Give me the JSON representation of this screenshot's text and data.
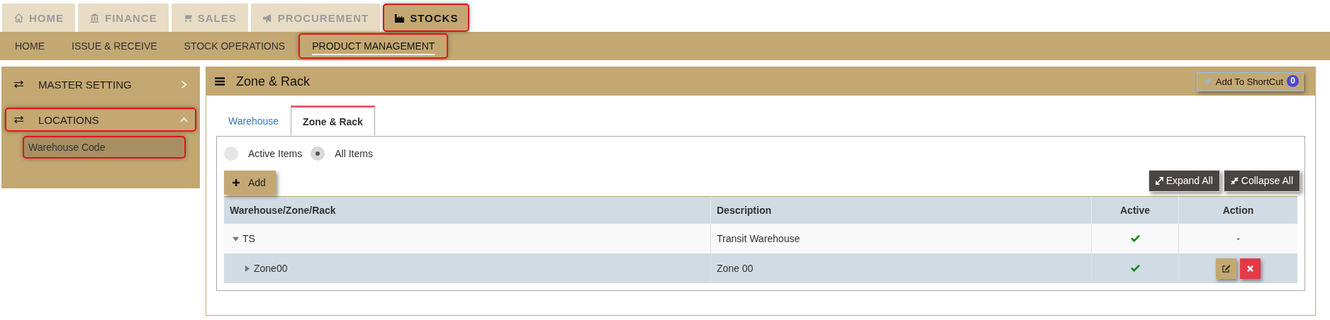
{
  "top_tabs": [
    {
      "label": "HOME",
      "kind": "home",
      "selected": false,
      "highlighted": false
    },
    {
      "label": "FINANCE",
      "kind": "bank",
      "selected": false,
      "highlighted": false
    },
    {
      "label": "SALES",
      "kind": "cart",
      "selected": false,
      "highlighted": false
    },
    {
      "label": "PROCUREMENT",
      "kind": "megaphone",
      "selected": false,
      "highlighted": false
    },
    {
      "label": "STOCKS",
      "kind": "factory",
      "selected": true,
      "highlighted": true
    }
  ],
  "sub_nav": [
    {
      "label": "HOME",
      "selected": false,
      "highlighted": false
    },
    {
      "label": "ISSUE & RECEIVE",
      "selected": false,
      "highlighted": false
    },
    {
      "label": "STOCK OPERATIONS",
      "selected": false,
      "highlighted": false
    },
    {
      "label": "PRODUCT MANAGEMENT",
      "selected": true,
      "highlighted": true
    }
  ],
  "sidebar": {
    "items": [
      {
        "label": "MASTER SETTING",
        "expanded": false,
        "highlighted": false
      },
      {
        "label": "LOCATIONS",
        "expanded": true,
        "highlighted": true,
        "children": [
          {
            "label": "Warehouse Code",
            "selected": true,
            "highlighted": true
          }
        ]
      }
    ]
  },
  "panel": {
    "title": "Zone & Rack",
    "shortcut_button": {
      "label": "Add To ShortCut",
      "badge": "0"
    },
    "tabs": [
      {
        "label": "Warehouse",
        "selected": false
      },
      {
        "label": "Zone & Rack",
        "selected": true
      }
    ],
    "filters": [
      {
        "label": "Active Items",
        "selected": false
      },
      {
        "label": "All Items",
        "selected": true
      }
    ],
    "add_button": "Add",
    "expand_button": "Expand All",
    "collapse_button": "Collapse All",
    "table": {
      "columns": [
        "Warehouse/Zone/Rack",
        "Description",
        "Active",
        "Action"
      ],
      "rows": [
        {
          "name": "TS",
          "description": "Transit Warehouse",
          "active": true,
          "editable": false,
          "action_text": "-",
          "expanded": true,
          "children": [
            {
              "name": "Zone00",
              "description": "Zone 00",
              "active": true,
              "editable": true,
              "expanded": false
            }
          ]
        }
      ]
    }
  }
}
